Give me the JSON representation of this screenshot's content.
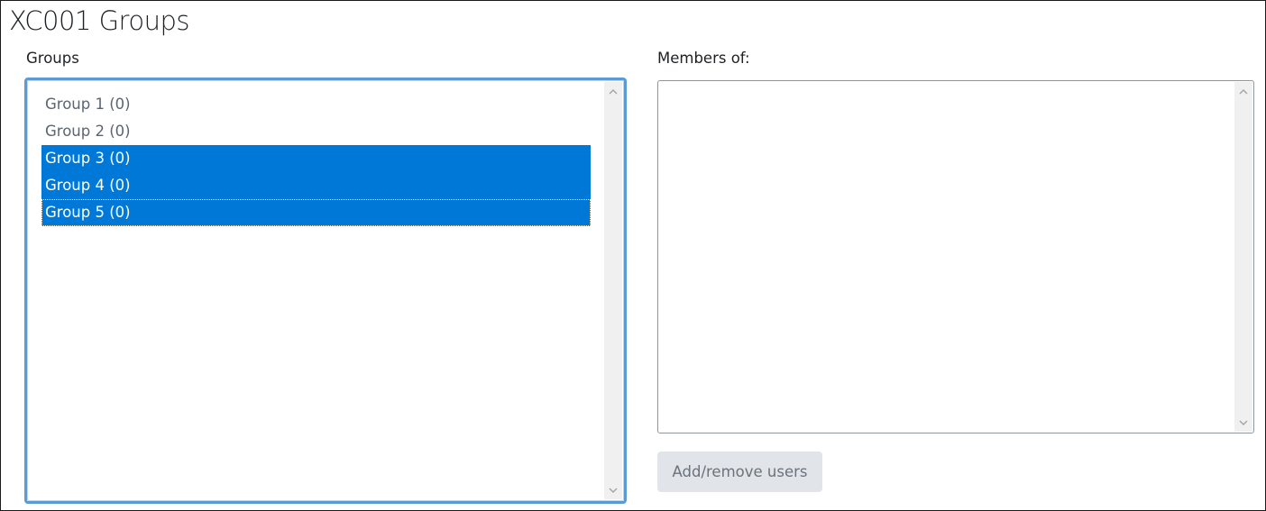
{
  "page": {
    "title": "XC001 Groups"
  },
  "groups": {
    "label": "Groups",
    "options": [
      {
        "label": "Group 1 (0)",
        "selected": false
      },
      {
        "label": "Group 2 (0)",
        "selected": false
      },
      {
        "label": "Group 3 (0)",
        "selected": true
      },
      {
        "label": "Group 4 (0)",
        "selected": true
      },
      {
        "label": "Group 5 (0)",
        "selected": true
      }
    ]
  },
  "members": {
    "label": "Members of:"
  },
  "actions": {
    "add_remove_label": "Add/remove users"
  },
  "colors": {
    "selection": "#0078d7",
    "focus_ring": "#5b9bd5",
    "button_bg": "#e1e4e8"
  },
  "icons": {
    "scroll_up": "chevron-up-icon",
    "scroll_down": "chevron-down-icon"
  }
}
